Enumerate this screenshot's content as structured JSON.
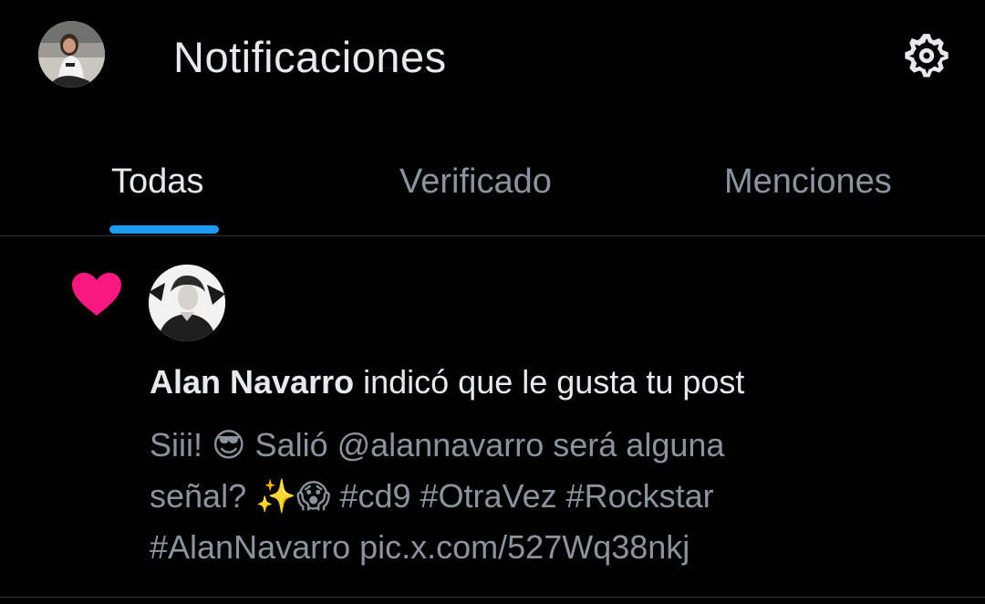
{
  "header": {
    "title": "Notificaciones",
    "settings_icon": "gear-icon"
  },
  "tabs": [
    {
      "label": "Todas",
      "active": true
    },
    {
      "label": "Verificado",
      "active": false
    },
    {
      "label": "Menciones",
      "active": false
    }
  ],
  "colors": {
    "background": "#000000",
    "text_primary": "#e7e9ea",
    "text_secondary": "#8b949e",
    "accent": "#1d9bf0",
    "like": "#f91880",
    "divider": "#2f3336"
  },
  "notification": {
    "icon": "heart-icon",
    "actor_name": "Alan Navarro",
    "action_text": "indicó que le gusta tu post",
    "post_lines": [
      "Siii! 😎 Salió @alannavarro será alguna",
      "señal? ✨😱 #cd9 #OtraVez #Rockstar",
      "#AlanNavarro pic.x.com/527Wq38nkj"
    ]
  }
}
